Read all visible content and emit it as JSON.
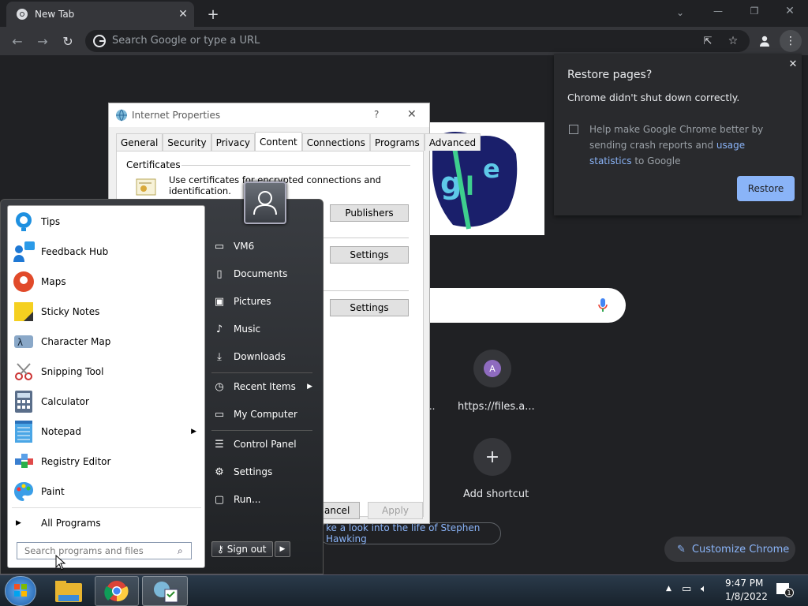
{
  "browser": {
    "tab_title": "New Tab",
    "omnibox_placeholder": "Search Google or type a URL"
  },
  "restore": {
    "title": "Restore pages?",
    "subtitle": "Chrome didn't shut down correctly.",
    "help_prefix": "Help make Google Chrome better by sending crash reports and ",
    "help_link": "usage statistics",
    "help_suffix": " to Google",
    "button": "Restore"
  },
  "ntp": {
    "shortcut1_letter": "A",
    "shortcut1_label": "https://files.a...",
    "shortcut0_label": "...",
    "add_shortcut": "Add shortcut",
    "doodle_link": "ke a look into the life of Stephen Hawking",
    "customize": "Customize Chrome"
  },
  "inet": {
    "title": "Internet Properties",
    "help": "?",
    "tabs": [
      "General",
      "Security",
      "Privacy",
      "Content",
      "Connections",
      "Programs",
      "Advanced"
    ],
    "cert_group": "Certificates",
    "cert_text": "Use certificates for encrypted connections and identification.",
    "publishers": "Publishers",
    "settings1": "Settings",
    "settings2": "Settings",
    "cancel": "ancel",
    "apply": "Apply"
  },
  "start": {
    "programs": [
      "Tips",
      "Feedback Hub",
      "Maps",
      "Sticky Notes",
      "Character Map",
      "Snipping Tool",
      "Calculator",
      "Notepad",
      "Registry Editor",
      "Paint"
    ],
    "all_programs": "All Programs",
    "search_placeholder": "Search programs and files",
    "right": [
      "VM6",
      "Documents",
      "Pictures",
      "Music",
      "Downloads",
      "Recent Items",
      "My Computer",
      "Control Panel",
      "Settings",
      "Run..."
    ],
    "sign_out": "Sign out"
  },
  "taskbar": {
    "time": "9:47 PM",
    "date": "1/8/2022",
    "notif_count": "1"
  }
}
